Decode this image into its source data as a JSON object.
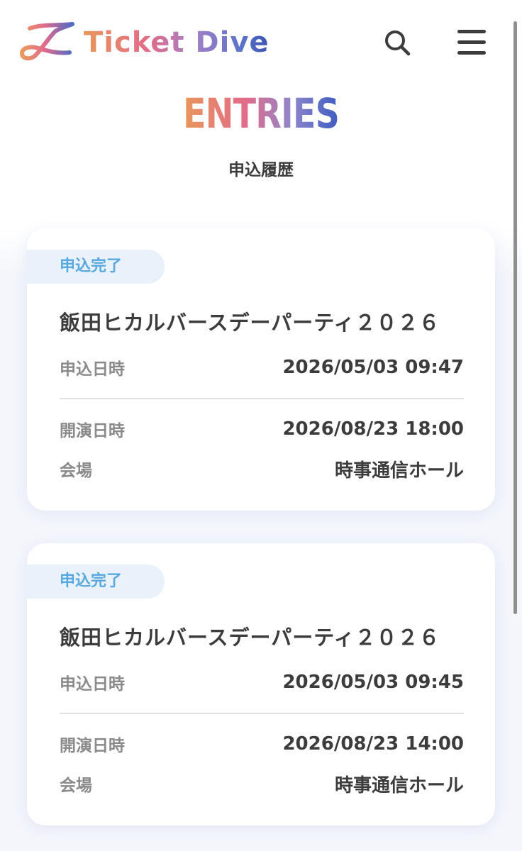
{
  "header": {
    "logo_text": "Ticket Dive",
    "search_icon": "search-icon",
    "menu_icon": "hamburger-menu-icon"
  },
  "page": {
    "title": "ENTRIES",
    "subtitle": "申込履歴"
  },
  "entries": [
    {
      "status": "申込完了",
      "event_title": "飯田ヒカルバースデーパーティ２０２６",
      "apply_label": "申込日時",
      "apply_datetime": "2026/05/03 09:47",
      "show_label": "開演日時",
      "show_datetime": "2026/08/23 18:00",
      "venue_label": "会場",
      "venue": "時事通信ホール"
    },
    {
      "status": "申込完了",
      "event_title": "飯田ヒカルバースデーパーティ２０２６",
      "apply_label": "申込日時",
      "apply_datetime": "2026/05/03 09:45",
      "show_label": "開演日時",
      "show_datetime": "2026/08/23 14:00",
      "venue_label": "会場",
      "venue": "時事通信ホール"
    }
  ],
  "colors": {
    "badge_bg": "#e9f2fb",
    "badge_text": "#58a8e0",
    "gradient_start": "#e9975a",
    "gradient_mid": "#e26b89",
    "gradient_end": "#3a55b3"
  }
}
